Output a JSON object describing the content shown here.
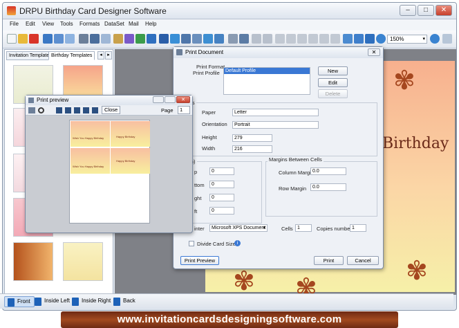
{
  "app": {
    "title": "DRPU Birthday Card Designer Software",
    "window_buttons": [
      "–",
      "□",
      "✕"
    ]
  },
  "menu": [
    "File",
    "Edit",
    "View",
    "Tools",
    "Formats",
    "DataSet",
    "Mail",
    "Help"
  ],
  "toolbar": {
    "zoom": "150%"
  },
  "left_panel": {
    "tabs": [
      "Invitation Templates",
      "Birthday Templates"
    ],
    "active_tab": 1,
    "thumbs_visible": 8
  },
  "canvas": {
    "card_text": "Birthday"
  },
  "view_bar": {
    "buttons": [
      "Front",
      "Inside Left",
      "Inside Right",
      "Back"
    ],
    "active": 0
  },
  "print_dialog": {
    "title": "Print Document",
    "print_format_label": "Print Format",
    "print_profile_label": "Print Profile",
    "profile_selected": "Default Profile",
    "btn_new": "New",
    "btn_edit": "Edit",
    "btn_delete": "Delete",
    "properties_label": "operties",
    "paper_label": "Paper",
    "paper_value": "Letter",
    "orientation_label": "Orientation",
    "orientation_value": "Portrait",
    "height_label": "Height",
    "height_value": "279",
    "width_label": "Width",
    "width_value": "216",
    "margin_label": "gin(mm)",
    "margin_rows": [
      {
        "label": "p",
        "value": "0"
      },
      {
        "label": "ttom",
        "value": "0"
      },
      {
        "label": "ght",
        "value": "0"
      },
      {
        "label": "ft",
        "value": "0"
      }
    ],
    "margins_between_label": "Margins Between Cells",
    "column_margin_label": "Column Margin",
    "column_margin_value": "0.0",
    "row_margin_label": "Row Margin",
    "row_margin_value": "0.0",
    "printer_label": "inter",
    "printer_value": "Microsoft XPS Document",
    "cells_label": "Cells",
    "cells_value": "1",
    "copies_label": "Copies number",
    "copies_value": "1",
    "divide_card_label": "Divide Card Size",
    "btn_preview": "Print Preview",
    "btn_print": "Print",
    "btn_cancel": "Cancel"
  },
  "print_preview": {
    "title": "Print preview",
    "close_label": "Close",
    "page_label": "Page",
    "page_value": "1",
    "cell_texts": [
      "Wish You Happy Birthday",
      "Happy Birthday",
      "Wish You Happy Birthday",
      "Happy Birthday"
    ]
  },
  "banner": {
    "text": "www.invitationcardsdesigningsoftware.com"
  },
  "colors": {
    "accent": "#1e62b8",
    "banner": "#8a3a1a",
    "card_text": "#6b2a19"
  }
}
